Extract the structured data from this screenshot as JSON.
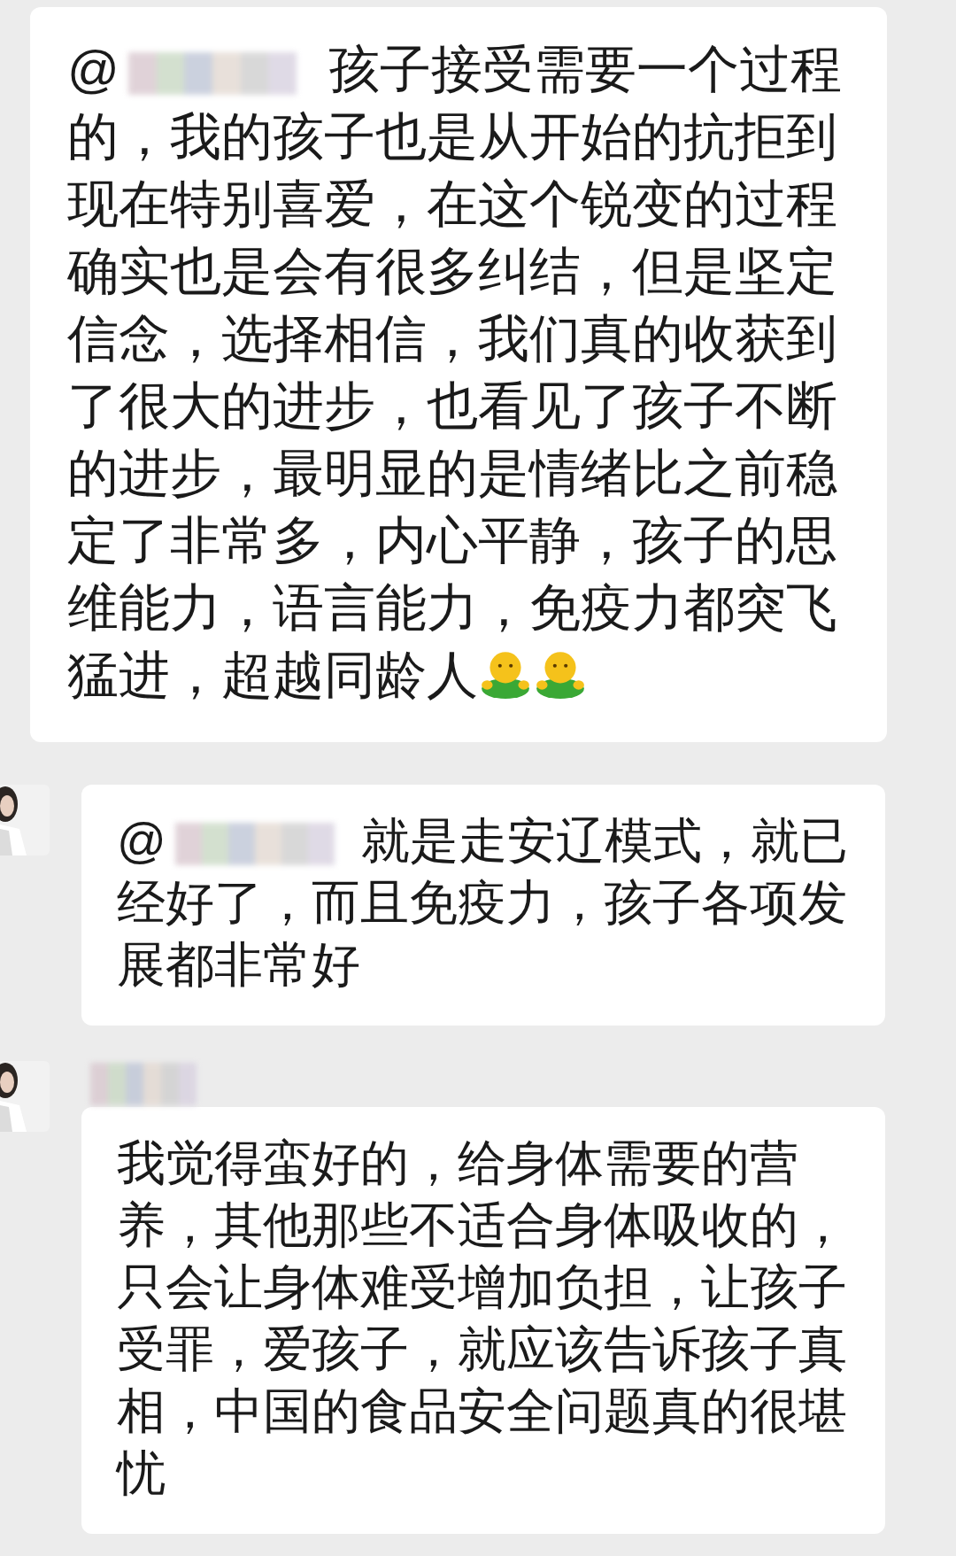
{
  "messages": [
    {
      "avatar": false,
      "sender_hidden": false,
      "mention": {
        "symbol": "@",
        "blurred": true
      },
      "text": "孩子接受需要一个过程的，我的孩子也是从开始的抗拒到现在特别喜爱，在这个锐变的过程确实也是会有很多纠结，但是坚定信念，选择相信，我们真的收获到了很大的进步，也看见了孩子不断的进步，最明显的是情绪比之前稳定了非常多，内心平静，孩子的思维能力，语言能力，免疫力都突飞猛进，超越同龄人",
      "emojis": [
        {
          "kind": "hug"
        },
        {
          "kind": "hug"
        }
      ]
    },
    {
      "avatar": true,
      "sender_hidden": false,
      "mention": {
        "symbol": "@",
        "blurred": true
      },
      "text": "就是走安辽模式，就已经好了，而且免疫力，孩子各项发展都非常好"
    },
    {
      "avatar": true,
      "sender_hidden": true,
      "text": "我觉得蛮好的，给身体需要的营养，其他那些不适合身体吸收的，只会让身体难受增加负担，让孩子受罪，爱孩子，就应该告诉孩子真相，中国的食品安全问题真的很堪忧"
    }
  ]
}
